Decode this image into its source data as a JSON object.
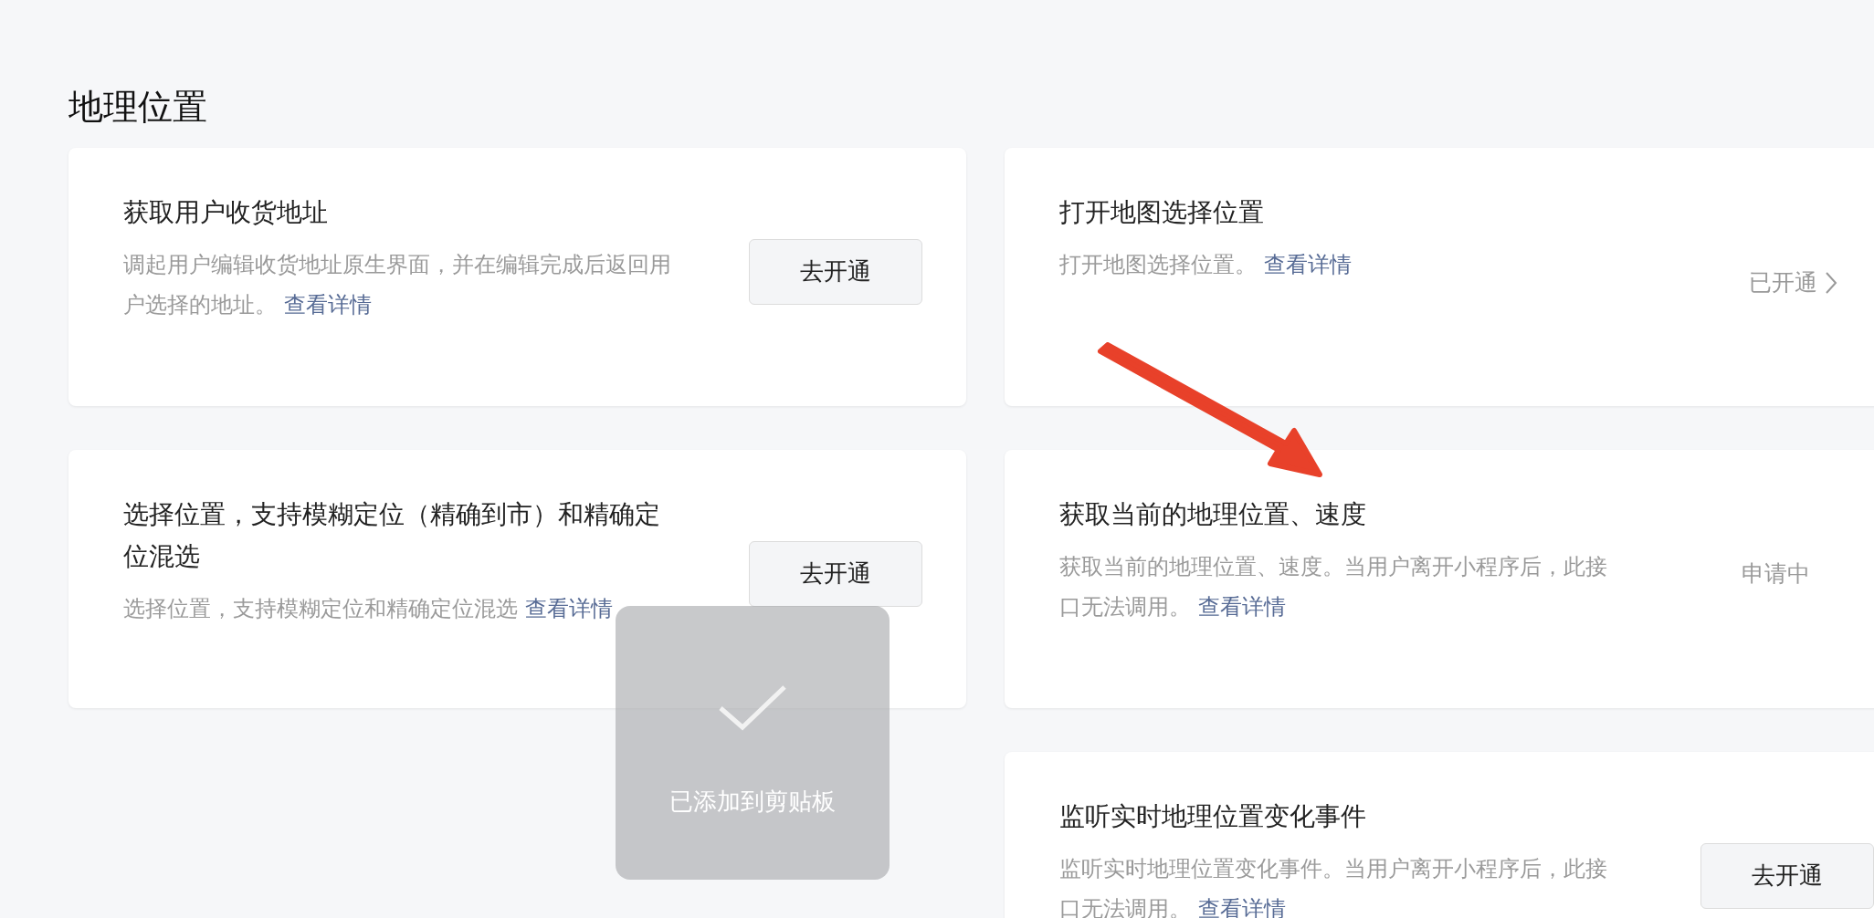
{
  "section": {
    "title": "地理位置"
  },
  "columns": [
    [
      {
        "title": "获取用户收货地址",
        "description": "调起用户编辑收货地址原生界面，并在编辑完成后返回用户选择的地址。",
        "link": "查看详情",
        "action": {
          "kind": "button",
          "label": "去开通"
        }
      },
      {
        "title": "选择位置，支持模糊定位（精确到市）和精确定位混选",
        "description": "选择位置，支持模糊定位和精确定位混选",
        "link": "查看详情",
        "action": {
          "kind": "button",
          "label": "去开通"
        }
      }
    ],
    [
      {
        "title": "打开地图选择位置",
        "description": "打开地图选择位置。",
        "link": "查看详情",
        "action": {
          "kind": "status_link",
          "label": "已开通"
        }
      },
      {
        "title": "获取当前的地理位置、速度",
        "description": "获取当前的地理位置、速度。当用户离开小程序后，此接口无法调用。",
        "link": "查看详情",
        "action": {
          "kind": "status",
          "label": "申请中"
        }
      },
      {
        "title": "监听实时地理位置变化事件",
        "description": "监听实时地理位置变化事件。当用户离开小程序后，此接口无法调用。",
        "link": "查看详情",
        "action": {
          "kind": "button",
          "label": "去开通"
        }
      }
    ]
  ],
  "toast": {
    "message": "已添加到剪贴板"
  }
}
